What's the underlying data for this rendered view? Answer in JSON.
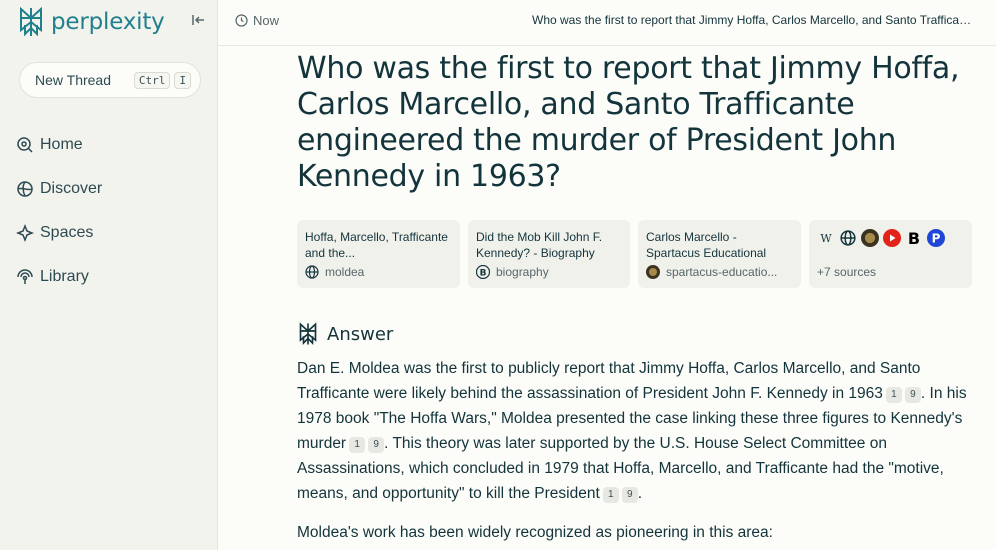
{
  "sidebar": {
    "brand": "perplexity",
    "new_thread": {
      "label": "New Thread",
      "kbd1": "Ctrl",
      "kbd2": "I"
    },
    "nav": [
      {
        "label": "Home",
        "icon": "home-icon"
      },
      {
        "label": "Discover",
        "icon": "globe-icon"
      },
      {
        "label": "Spaces",
        "icon": "spaces-icon"
      },
      {
        "label": "Library",
        "icon": "library-icon"
      }
    ]
  },
  "topbar": {
    "time_label": "Now",
    "title": "Who was the first to report that Jimmy Hoffa, Carlos Marcello, and Santo Trafficante engineered the murder of President John Kennedy in 1963?"
  },
  "question": "Who was the first to report that Jimmy Hoffa, Carlos Marcello, and Santo Trafficante engineered the murder of President John Kennedy in 1963?",
  "sources": [
    {
      "title": "Hoffa, Marcello, Trafficante and the...",
      "site": "moldea"
    },
    {
      "title": "Did the Mob Kill John F. Kennedy? - Biography",
      "site": "biography"
    },
    {
      "title": "Carlos Marcello - Spartacus Educational",
      "site": "spartacus-educatio..."
    }
  ],
  "more_sources": "+7 sources",
  "answer": {
    "heading": "Answer",
    "p1_a": "Dan E. Moldea was the first to publicly report that Jimmy Hoffa, Carlos Marcello, and Santo Trafficante were likely behind the assassination of President John F. Kennedy in 1963",
    "p1_b": ". In his 1978 book \"The Hoffa Wars,\" Moldea presented the case linking these three figures to Kennedy's murder",
    "p1_c": ". This theory was later supported by the U.S. House Select Committee on Assassinations, which concluded in 1979 that Hoffa, Marcello, and Trafficante had the \"motive, means, and opportunity\" to kill the President",
    "p1_d": ".",
    "cite1": "1",
    "cite2": "9",
    "p2": "Moldea's work has been widely recognized as pioneering in this area:"
  }
}
